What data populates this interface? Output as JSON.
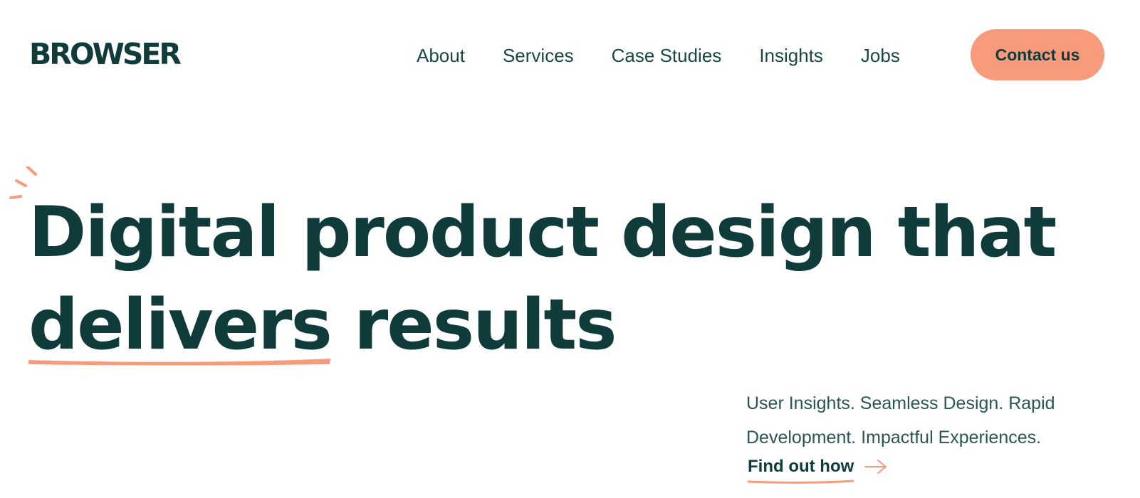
{
  "header": {
    "logo_text": "BROWSER",
    "nav": [
      {
        "label": "About"
      },
      {
        "label": "Services"
      },
      {
        "label": "Case Studies"
      },
      {
        "label": "Insights"
      },
      {
        "label": "Jobs"
      }
    ],
    "contact_label": "Contact us"
  },
  "hero": {
    "headline_line1": "Digital product design that",
    "headline_highlight": "delivers",
    "headline_rest": "results",
    "subtext_line1": "User Insights. Seamless Design. Rapid",
    "subtext_line2": "Development. Impactful Experiences.",
    "cta_label": "Find out how"
  },
  "icons": {
    "sparkle": "sparkle-icon",
    "arrow": "arrow-right-icon"
  },
  "colors": {
    "primary_text": "#0f3b3a",
    "accent": "#f79b7c",
    "background": "#ffffff"
  }
}
